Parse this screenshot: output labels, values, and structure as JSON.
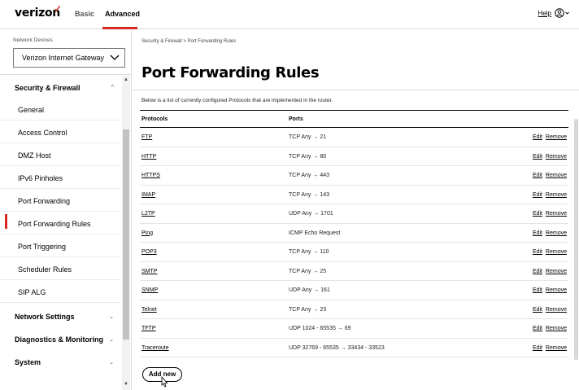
{
  "header": {
    "logo": "verizon",
    "logo_mark": "✓",
    "tabs": [
      "Basic",
      "Advanced"
    ],
    "help": "Help",
    "user_chevron": "⌄"
  },
  "sidebar": {
    "device_label": "Network Devices",
    "device_selected": "Verizon Internet Gateway",
    "section_security": "Security & Firewall",
    "security_chevron": "^",
    "items": [
      "General",
      "Access Control",
      "DMZ Host",
      "IPv6 Pinholes",
      "Port Forwarding",
      "Port Forwarding Rules",
      "Port Triggering",
      "Scheduler Rules",
      "SIP ALG"
    ],
    "active_item": "Port Forwarding Rules",
    "sections": [
      "Network Settings",
      "Diagnostics & Monitoring",
      "System"
    ],
    "section_chevron": "⌄"
  },
  "main": {
    "breadcrumb": "Security & Firewall > Port Forwarding Rules",
    "title": "Port Forwarding Rules",
    "description": "Below is a list of currently configured Protocols that are implemented in the router.",
    "columns": [
      "Protocols",
      "Ports"
    ],
    "rows": [
      {
        "protocol": "FTP",
        "ports": "TCP Any → 21"
      },
      {
        "protocol": "HTTP",
        "ports": "TCP Any → 80"
      },
      {
        "protocol": "HTTPS",
        "ports": "TCP Any → 443"
      },
      {
        "protocol": "IMAP",
        "ports": "TCP Any → 143"
      },
      {
        "protocol": "L2TP",
        "ports": "UDP Any → 1701"
      },
      {
        "protocol": "Ping",
        "ports": "ICMP Echo Request"
      },
      {
        "protocol": "POP3",
        "ports": "TCP Any → 110"
      },
      {
        "protocol": "SMTP",
        "ports": "TCP Any → 25"
      },
      {
        "protocol": "SNMP",
        "ports": "UDP Any → 161"
      },
      {
        "protocol": "Telnet",
        "ports": "TCP Any → 23"
      },
      {
        "protocol": "TFTP",
        "ports": "UDP 1024 - 65535 → 69"
      },
      {
        "protocol": "Traceroute",
        "ports": "UDP 32769 - 65535 → 33434 - 33523"
      }
    ],
    "edit_label": "Edit",
    "remove_label": "Remove",
    "add_label": "Add new"
  },
  "colors": {
    "accent": "#d52b1e"
  }
}
